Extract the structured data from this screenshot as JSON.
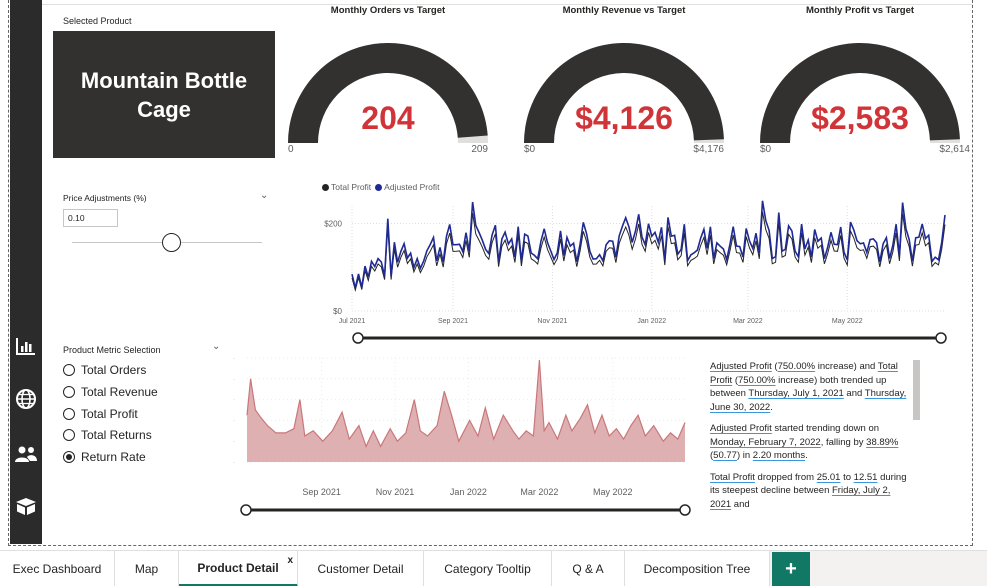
{
  "selected_product": {
    "label": "Selected Product",
    "name": "Mountain Bottle Cage"
  },
  "gauges": [
    {
      "title": "Monthly Orders vs Target",
      "value": "204",
      "min": "0",
      "max": "209",
      "fraction": 0.976
    },
    {
      "title": "Monthly Revenue vs Target",
      "value": "$4,126",
      "min": "$0",
      "max": "$4,176",
      "fraction": 0.988
    },
    {
      "title": "Monthly Profit vs Target",
      "value": "$2,583",
      "min": "$0",
      "max": "$2,614",
      "fraction": 0.988
    }
  ],
  "price_adjustment": {
    "label": "Price Adjustments (%)",
    "value": "0.10",
    "slider_fraction": 0.52
  },
  "metric_selection": {
    "label": "Product Metric Selection",
    "options": [
      {
        "label": "Total Orders",
        "checked": false
      },
      {
        "label": "Total Revenue",
        "checked": false
      },
      {
        "label": "Total Profit",
        "checked": false
      },
      {
        "label": "Total Returns",
        "checked": false
      },
      {
        "label": "Return Rate",
        "checked": true
      }
    ]
  },
  "chart_data": [
    {
      "type": "line",
      "legend": [
        "Total Profit",
        "Adjusted Profit"
      ],
      "series": [
        {
          "name": "Total Profit",
          "color": "#252423"
        },
        {
          "name": "Adjusted Profit",
          "color": "#1f2a94"
        }
      ],
      "y_ticks": [
        "$200",
        "$0"
      ],
      "ylim": [
        0,
        240
      ],
      "x_ticks": [
        "Jul 2021",
        "Sep 2021",
        "Nov 2021",
        "Jan 2022",
        "Mar 2022",
        "May 2022"
      ],
      "x_range": [
        "2021-07-01",
        "2022-06-30"
      ],
      "legend_position": "top-left",
      "grid": true
    },
    {
      "type": "area",
      "color": "#c9777a",
      "x_ticks": [
        "Sep 2021",
        "Nov 2021",
        "Jan 2022",
        "Mar 2022",
        "May 2022"
      ],
      "x_range": [
        "2021-07-01",
        "2022-06-30"
      ],
      "grid": true,
      "points": [
        [
          "2021-07-01",
          0.45
        ],
        [
          "2021-07-04",
          0.8
        ],
        [
          "2021-07-08",
          0.5
        ],
        [
          "2021-07-13",
          0.42
        ],
        [
          "2021-07-18",
          0.35
        ],
        [
          "2021-07-25",
          0.28
        ],
        [
          "2021-08-02",
          0.28
        ],
        [
          "2021-08-09",
          0.32
        ],
        [
          "2021-08-14",
          0.6
        ],
        [
          "2021-08-18",
          0.25
        ],
        [
          "2021-08-25",
          0.3
        ],
        [
          "2021-09-02",
          0.2
        ],
        [
          "2021-09-10",
          0.3
        ],
        [
          "2021-09-18",
          0.48
        ],
        [
          "2021-09-24",
          0.22
        ],
        [
          "2021-10-02",
          0.35
        ],
        [
          "2021-10-08",
          0.15
        ],
        [
          "2021-10-14",
          0.3
        ],
        [
          "2021-10-20",
          0.15
        ],
        [
          "2021-10-28",
          0.32
        ],
        [
          "2021-11-03",
          0.2
        ],
        [
          "2021-11-10",
          0.28
        ],
        [
          "2021-11-17",
          0.6
        ],
        [
          "2021-11-22",
          0.3
        ],
        [
          "2021-11-28",
          0.25
        ],
        [
          "2021-12-06",
          0.35
        ],
        [
          "2021-12-12",
          0.68
        ],
        [
          "2021-12-18",
          0.45
        ],
        [
          "2021-12-24",
          0.2
        ],
        [
          "2022-01-02",
          0.4
        ],
        [
          "2022-01-09",
          0.25
        ],
        [
          "2022-01-15",
          0.52
        ],
        [
          "2022-01-22",
          0.22
        ],
        [
          "2022-01-30",
          0.45
        ],
        [
          "2022-02-07",
          0.3
        ],
        [
          "2022-02-12",
          0.22
        ],
        [
          "2022-02-18",
          0.3
        ],
        [
          "2022-02-24",
          0.25
        ],
        [
          "2022-03-01",
          0.98
        ],
        [
          "2022-03-05",
          0.3
        ],
        [
          "2022-03-09",
          0.38
        ],
        [
          "2022-03-16",
          0.22
        ],
        [
          "2022-03-23",
          0.45
        ],
        [
          "2022-03-28",
          0.3
        ],
        [
          "2022-04-04",
          0.42
        ],
        [
          "2022-04-10",
          0.55
        ],
        [
          "2022-04-16",
          0.28
        ],
        [
          "2022-04-22",
          0.45
        ],
        [
          "2022-04-28",
          0.25
        ],
        [
          "2022-05-04",
          0.32
        ],
        [
          "2022-05-10",
          0.22
        ],
        [
          "2022-05-16",
          0.35
        ],
        [
          "2022-05-22",
          0.45
        ],
        [
          "2022-05-28",
          0.25
        ],
        [
          "2022-06-04",
          0.35
        ],
        [
          "2022-06-12",
          0.2
        ],
        [
          "2022-06-18",
          0.28
        ],
        [
          "2022-06-24",
          0.22
        ],
        [
          "2022-06-30",
          0.38
        ]
      ]
    }
  ],
  "narrative": {
    "p1": {
      "a": "Adjusted Profit",
      "b": " (",
      "c": "750.00%",
      "d": " increase) and ",
      "e": "Total Profit",
      "f": " (",
      "g": "750.00%",
      "h": " increase) both trended up between ",
      "i": "Thursday, July 1, 2021",
      "j": " and ",
      "k": "Thursday, June 30, 2022",
      "l": "."
    },
    "p2": {
      "a": "Adjusted Profit",
      "b": " started trending down on ",
      "c": "Monday, February 7, 2022",
      "d": ", falling by ",
      "e": "38.89%",
      "f": " (",
      "g": "50.77",
      "h": ") in ",
      "i": "2.20 months",
      "j": "."
    },
    "p3": {
      "a": "Total Profit",
      "b": " dropped from ",
      "c": "25.01",
      "d": " to ",
      "e": "12.51",
      "f": " during its steepest decline between ",
      "g": "Friday, July 2, 2021",
      "h": " and"
    }
  },
  "tabs": [
    {
      "label": "Exec Dashboard",
      "active": false
    },
    {
      "label": "Map",
      "active": false
    },
    {
      "label": "Product Detail",
      "active": true
    },
    {
      "label": "Customer Detail",
      "active": false
    },
    {
      "label": "Category Tooltip",
      "active": false
    },
    {
      "label": "Q & A",
      "active": false
    },
    {
      "label": "Decomposition Tree",
      "active": false
    }
  ],
  "icons": {
    "rail": [
      "bar-chart-icon",
      "globe-icon",
      "people-icon",
      "box-icon"
    ],
    "tab_close": "x",
    "add_page": "+"
  },
  "colors": {
    "accent": "#117865",
    "gauge_value": "#d13438",
    "gauge_arc": "#323130"
  }
}
